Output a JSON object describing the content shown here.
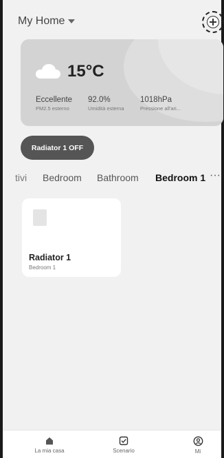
{
  "header": {
    "home_name": "My Home",
    "add_icon": "plus-icon"
  },
  "weather": {
    "icon": "cloud-icon",
    "temperature": "15°C",
    "metrics": [
      {
        "value": "Eccellente",
        "label": "PM2.5 esterno"
      },
      {
        "value": "92.0%",
        "label": "Umidità esterna"
      },
      {
        "value": "1018hPa",
        "label": "Pressione all'ari..."
      }
    ]
  },
  "scene": {
    "label": "Radiator 1 OFF"
  },
  "rooms": {
    "tabs": [
      "tivi",
      "Bedroom",
      "Bathroom",
      "Bedroom 1"
    ],
    "active": "Bedroom 1",
    "more": "···"
  },
  "devices": [
    {
      "name": "Radiator 1",
      "room": "Bedroom 1"
    }
  ],
  "nav": [
    {
      "label": "La mia casa",
      "icon": "home-icon"
    },
    {
      "label": "Scenario",
      "icon": "checkbox-icon"
    },
    {
      "label": "Mi",
      "icon": "profile-icon"
    }
  ],
  "colors": {
    "background": "#f1f1f1",
    "card": "#ffffff",
    "pill": "#555555",
    "weather_card": "#d3d3d3"
  }
}
